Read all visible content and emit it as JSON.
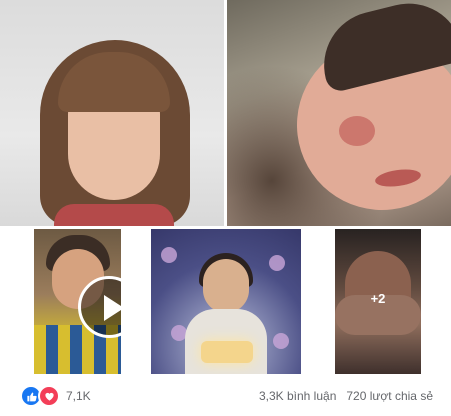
{
  "gallery": {
    "more_overlay": "+2"
  },
  "footer": {
    "reactions_count": "7,1K",
    "comments": "3,3K bình luận",
    "shares": "720 lượt chia sẻ"
  },
  "icons": {
    "like": "like-icon",
    "love": "love-icon",
    "play": "play-icon"
  },
  "colors": {
    "like": "#1877f2",
    "love": "#f33e58",
    "meta_text": "#65676b"
  }
}
